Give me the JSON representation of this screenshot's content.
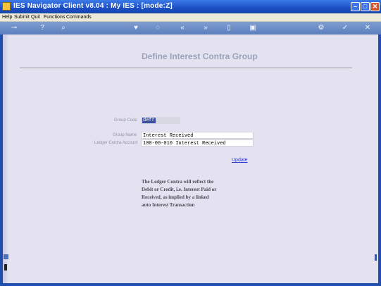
{
  "window": {
    "title": "IES Navigator Client v8.04 : My IES :     [mode:Z]",
    "min_label": "–",
    "max_label": "□",
    "close_label": "✕"
  },
  "menu": {
    "items": [
      "Help",
      "Submit",
      "Quit",
      "Functions",
      "Commands"
    ]
  },
  "toolbar": {
    "icons": [
      "key-icon",
      "help-icon",
      "search-icon",
      "heart-icon",
      "refresh-icon",
      "back-icon",
      "forward-icon",
      "page-icon",
      "print-icon",
      "settings-icon",
      "check-icon",
      "close-icon"
    ],
    "glyphs": [
      "⊸",
      "?",
      "⌕",
      "♥",
      "◌",
      "«",
      "»",
      "▯",
      "▣",
      "⚙",
      "✓",
      "✕"
    ]
  },
  "form": {
    "title": "Define Interest Contra Group",
    "group_code_label": "Group Code",
    "group_code_value": "defr",
    "group_name_label": "Group Name",
    "group_name_value": "Interest Received",
    "ledger_label": "Ledger Contra Account",
    "ledger_value": "100-00-010 Interest Received",
    "update_label": "Update"
  },
  "note": {
    "lines": [
      "The Ledger Contra will reflect the",
      "Debit or Credit, i.e. Interest Paid or",
      "Received, as implied by a linked",
      "auto Interest Transaction"
    ]
  }
}
